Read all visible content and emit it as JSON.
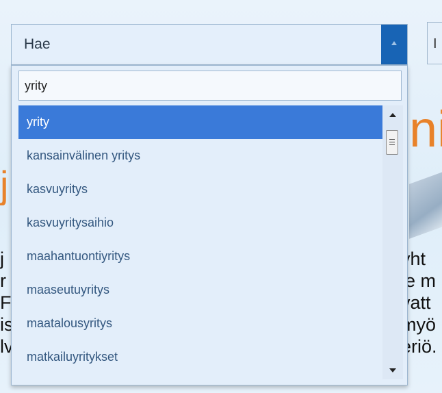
{
  "background": {
    "heading_fragment": "ni",
    "left_fragment": "j",
    "right_box_fragment": "I",
    "right_text_lines": [
      "yht",
      "le m",
      "vatt",
      "myö",
      "eriö."
    ],
    "left_text_lines": [
      "j",
      "r",
      "F",
      "is",
      "lv"
    ],
    "colors": {
      "accent": "#e8822a"
    }
  },
  "combobox": {
    "label": "Hae",
    "arrow_icon": "triangle-up-icon",
    "colors": {
      "arrow_bg": "#1864b5",
      "field_bg": "#e4effb"
    }
  },
  "dropdown": {
    "search_value": "yrity",
    "options": [
      "yrity",
      "kansainvälinen yritys",
      "kasvuyritys",
      "kasvuyritysaihio",
      "maahantuontiyritys",
      "maaseutuyritys",
      "maatalousyritys",
      "matkailuyritykset"
    ],
    "selected_index": 0,
    "colors": {
      "selected_bg": "#3a7ad9",
      "option_text": "#33577f"
    }
  },
  "scrollbar": {
    "up_icon": "scroll-up-arrow-icon",
    "down_icon": "scroll-down-arrow-icon",
    "thumb_icon": "scroll-thumb-grip-icon"
  }
}
